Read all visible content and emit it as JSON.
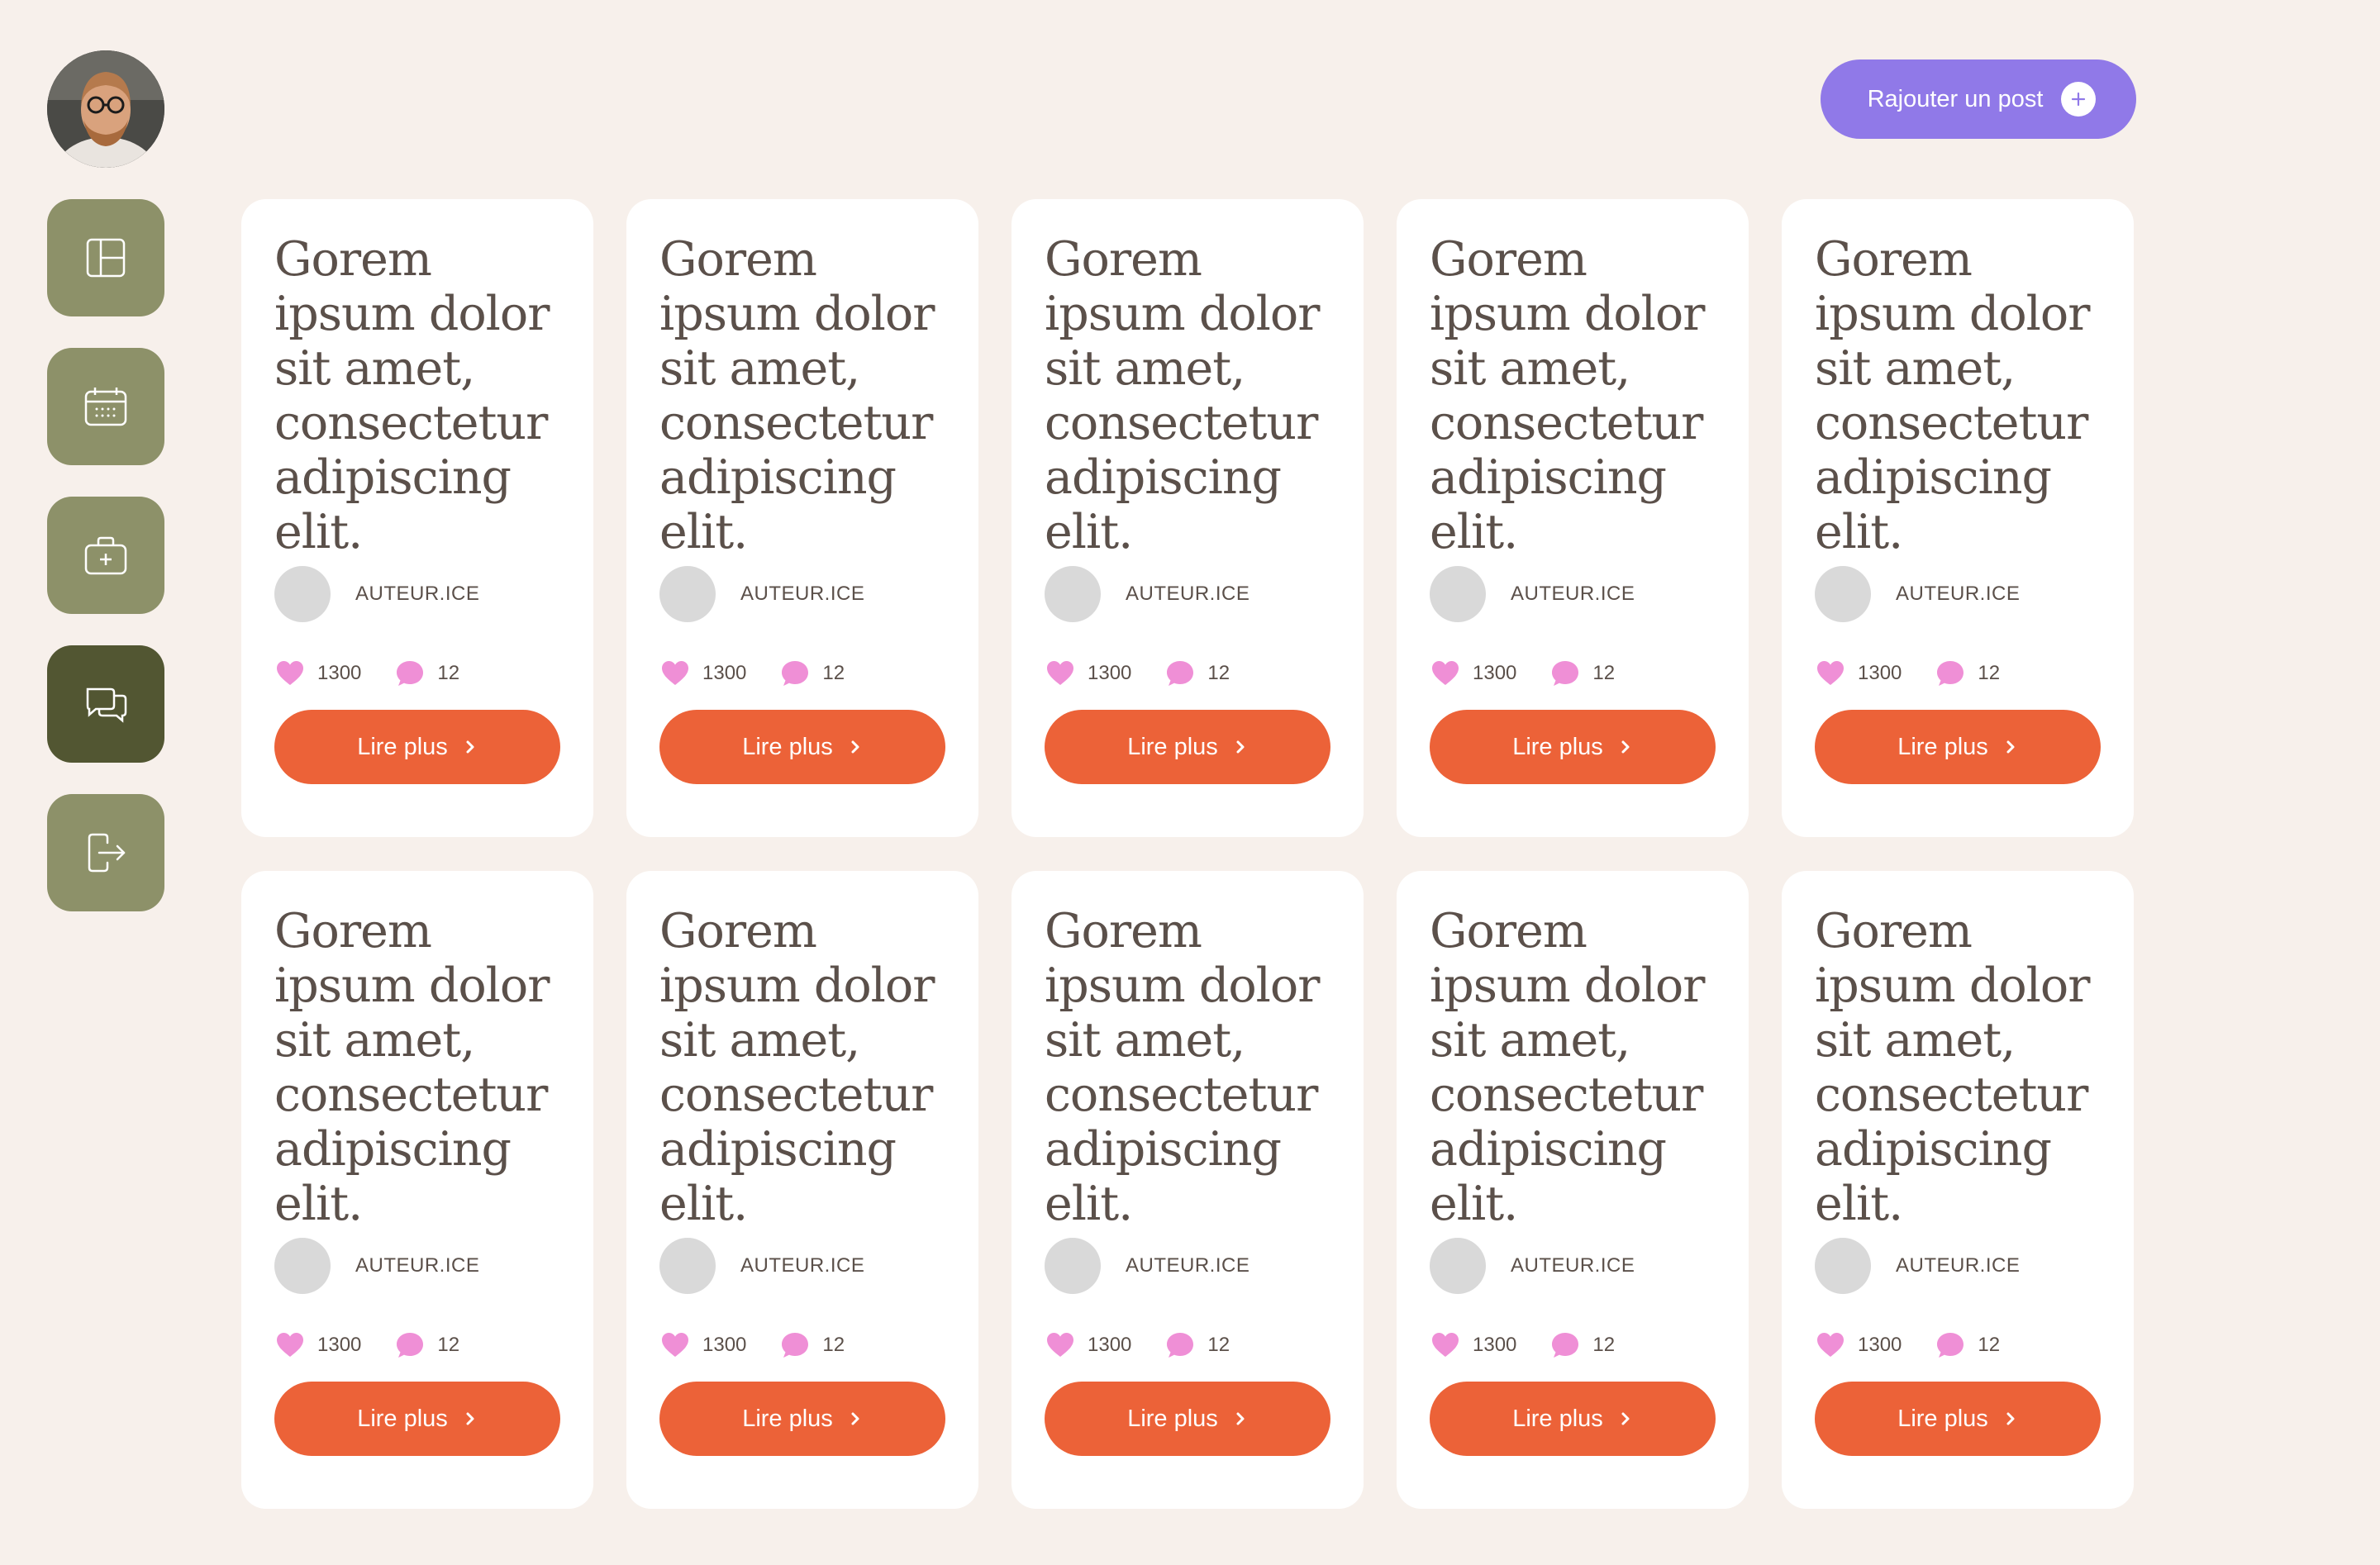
{
  "sidebar": {
    "items": [
      {
        "name": "dashboard-icon",
        "active": false
      },
      {
        "name": "calendar-icon",
        "active": false
      },
      {
        "name": "medical-kit-icon",
        "active": false
      },
      {
        "name": "chat-bubbles-icon",
        "active": true
      },
      {
        "name": "logout-icon",
        "active": false
      }
    ]
  },
  "header": {
    "add_post_label": "Rajouter un post"
  },
  "colors": {
    "background": "#f7f0eb",
    "nav": "#8d9169",
    "nav_active": "#525632",
    "accent_button": "#9079e8",
    "read_button": "#ec6238",
    "icon_pink": "#ef8fd6"
  },
  "cards": [
    {
      "title": "Gorem ipsum dolor sit amet, consectetur adipiscing elit.",
      "author": "AUTEUR.ICE",
      "likes": "1300",
      "comments": "12",
      "button": "Lire plus"
    },
    {
      "title": "Gorem ipsum dolor sit amet, consectetur adipiscing elit.",
      "author": "AUTEUR.ICE",
      "likes": "1300",
      "comments": "12",
      "button": "Lire plus"
    },
    {
      "title": "Gorem ipsum dolor sit amet, consectetur adipiscing elit.",
      "author": "AUTEUR.ICE",
      "likes": "1300",
      "comments": "12",
      "button": "Lire plus"
    },
    {
      "title": "Gorem ipsum dolor sit amet, consectetur adipiscing elit.",
      "author": "AUTEUR.ICE",
      "likes": "1300",
      "comments": "12",
      "button": "Lire plus"
    },
    {
      "title": "Gorem ipsum dolor sit amet, consectetur adipiscing elit.",
      "author": "AUTEUR.ICE",
      "likes": "1300",
      "comments": "12",
      "button": "Lire plus"
    },
    {
      "title": "Gorem ipsum dolor sit amet, consectetur adipiscing elit.",
      "author": "AUTEUR.ICE",
      "likes": "1300",
      "comments": "12",
      "button": "Lire plus"
    },
    {
      "title": "Gorem ipsum dolor sit amet, consectetur adipiscing elit.",
      "author": "AUTEUR.ICE",
      "likes": "1300",
      "comments": "12",
      "button": "Lire plus"
    },
    {
      "title": "Gorem ipsum dolor sit amet, consectetur adipiscing elit.",
      "author": "AUTEUR.ICE",
      "likes": "1300",
      "comments": "12",
      "button": "Lire plus"
    },
    {
      "title": "Gorem ipsum dolor sit amet, consectetur adipiscing elit.",
      "author": "AUTEUR.ICE",
      "likes": "1300",
      "comments": "12",
      "button": "Lire plus"
    },
    {
      "title": "Gorem ipsum dolor sit amet, consectetur adipiscing elit.",
      "author": "AUTEUR.ICE",
      "likes": "1300",
      "comments": "12",
      "button": "Lire plus"
    }
  ]
}
